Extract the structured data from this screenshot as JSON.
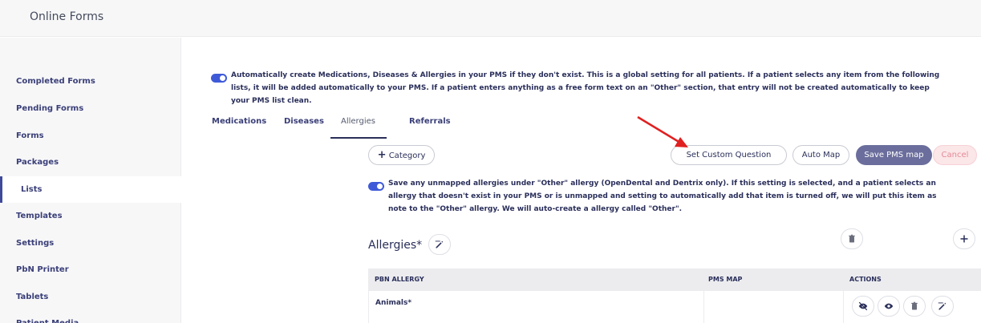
{
  "app": {
    "title": "Online Forms"
  },
  "sidebar": {
    "items": [
      {
        "label": "Completed Forms"
      },
      {
        "label": "Pending Forms"
      },
      {
        "label": "Forms"
      },
      {
        "label": "Packages"
      },
      {
        "label": "Lists"
      },
      {
        "label": "Templates"
      },
      {
        "label": "Settings"
      },
      {
        "label": "PbN Printer"
      },
      {
        "label": "Tablets"
      },
      {
        "label": "Patient Media"
      }
    ],
    "active": "Lists"
  },
  "global_setting": {
    "enabled": true,
    "line1": "Automatically create Medications, Diseases & Allergies in your PMS if they don't exist. This is a global setting for all patients. If a patient selects any item from the following",
    "line2": "lists, it will be added automatically to your PMS. If a patient enters anything as a free form text on an \"Other\" section, that entry will not be created automatically to keep",
    "line3": "your PMS list clean."
  },
  "tabs": [
    {
      "label": "Medications"
    },
    {
      "label": "Diseases"
    },
    {
      "label": "Allergies"
    },
    {
      "label": "Referrals"
    }
  ],
  "active_tab": "Allergies",
  "toolbar": {
    "category_label": "Category",
    "set_custom_question": "Set Custom Question",
    "auto_map": "Auto Map",
    "save_pms_map": "Save PMS map",
    "cancel": "Cancel"
  },
  "unmapped_setting": {
    "enabled": true,
    "line1": "Save any unmapped allergies under \"Other\" allergy (OpenDental and Dentrix only). If this setting is selected, and a patient selects an",
    "line2": "allergy that doesn't exist in your PMS or is unmapped and setting to automatically add that item is turned off, we will put this item as",
    "line3": "note to the \"Other\" allergy. We will auto-create a allergy called \"Other\"."
  },
  "section": {
    "title": "Allergies*"
  },
  "table": {
    "headers": [
      "PBN ALLERGY",
      "PMS MAP",
      "ACTIONS"
    ],
    "rows": [
      {
        "pbn_allergy": "Animals*",
        "pms_map": ""
      }
    ]
  },
  "colors": {
    "accent": "#3f5ad8",
    "nav_text": "#3a3f78",
    "primary_button": "#6b6e9c",
    "cancel_bg": "#fbe6e8",
    "cancel_text": "#e58a96",
    "annotation_arrow": "#e02020"
  },
  "icons": {
    "plus": "plus-icon",
    "edit": "edit-icon",
    "trash": "trash-icon",
    "hide": "eye-slash-icon",
    "view": "eye-icon"
  }
}
